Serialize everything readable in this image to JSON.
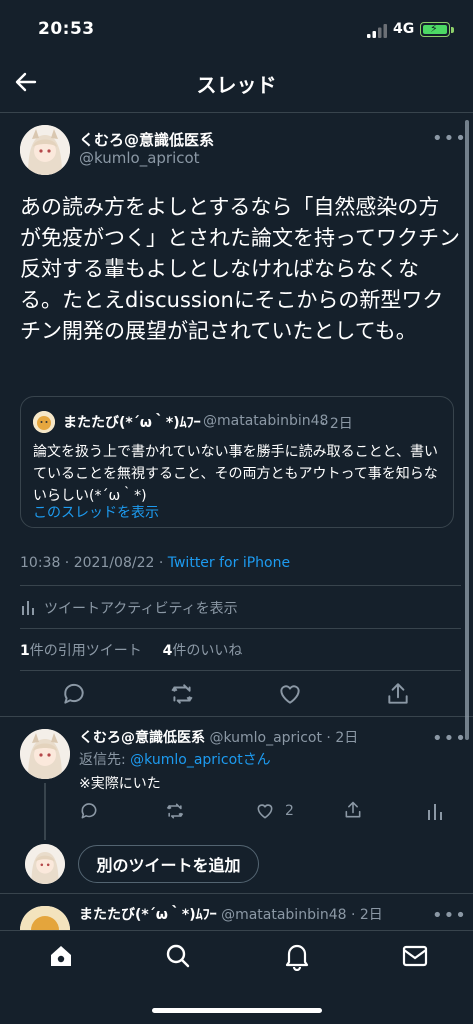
{
  "status": {
    "time": "20:53",
    "network": "4G"
  },
  "header": {
    "title": "スレッド"
  },
  "main_tweet": {
    "name": "くむろ@意識低医系",
    "handle": "@kumlo_apricot",
    "text": "あの読み方をよしとするなら「自然感染の方が免疫がつく」とされた論文を持ってワクチン反対する輩もよしとしなければならなくなる。たとえdiscussionにそこからの新型ワクチン開発の展望が記されていたとしても。",
    "quote": {
      "name": "またたび(*´ω｀*)ﾑﾌｰ",
      "handle": "@matatabinbin48",
      "time": "· 2日",
      "text": "論文を扱う上で書かれていない事を勝手に読み取ることと、書いていることを無視すること、その両方ともアウトって事を知らないらしい(*´ω｀*)",
      "link": "このスレッドを表示"
    },
    "datetime": "10:38 · 2021/08/22 · ",
    "source": "Twitter for iPhone",
    "activity": "ツイートアクティビティを表示",
    "stats": {
      "quotes_count": "1",
      "quotes_label": "件の引用ツイート",
      "likes_count": "4",
      "likes_label": "件のいいね"
    }
  },
  "reply": {
    "name": "くむろ@意識低医系",
    "handle": "@kumlo_apricot",
    "time": "· 2日",
    "replying_prefix": "返信先: ",
    "replying_handle": "@kumlo_apricot",
    "replying_suffix": "さん",
    "text": "※実際にいた",
    "like_count": "2"
  },
  "compose": {
    "add_label": "別のツイートを追加"
  },
  "next_tweet": {
    "name": "またたび(*´ω｀*)ﾑﾌｰ",
    "handle": "@matatabinbin48",
    "time": "· 2日"
  },
  "tabbar": {
    "items": [
      "home",
      "search",
      "notifications",
      "messages"
    ]
  },
  "colors": {
    "background": "#15202b",
    "accent": "#1d9bf0",
    "muted": "#8b98a5",
    "divider": "#38444d"
  }
}
